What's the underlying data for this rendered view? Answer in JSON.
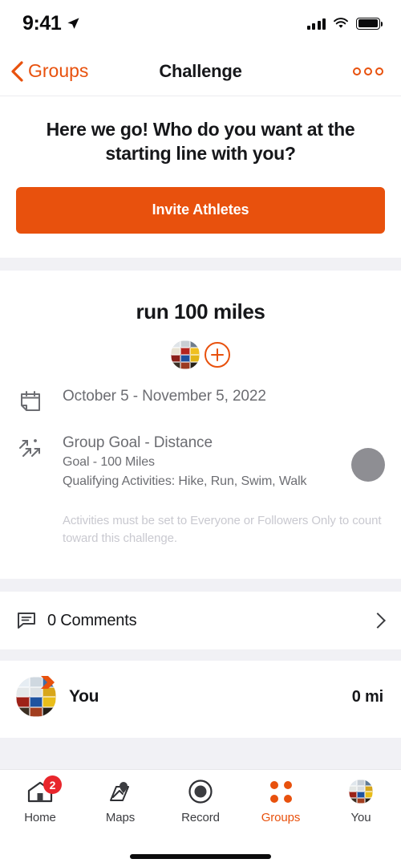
{
  "status_bar": {
    "time": "9:41",
    "location_icon": "location-arrow-icon",
    "signal_icon": "cellular-signal-icon",
    "wifi_icon": "wifi-icon",
    "battery_icon": "battery-full-icon"
  },
  "nav_bar": {
    "back_icon": "chevron-left-icon",
    "back_label": "Groups",
    "title": "Challenge",
    "more_icon": "more-options-icon"
  },
  "invite": {
    "headline": "Here we go! Who do you want at the starting line with you?",
    "button_label": "Invite Athletes"
  },
  "challenge": {
    "title": "run 100 miles",
    "avatar_name": "challenge-member-avatar",
    "add_button_icon": "plus-circle-icon",
    "rows": [
      {
        "icon": "calendar-icon",
        "main": "October 5 - November 5, 2022",
        "sub_lines": []
      },
      {
        "icon": "goal-arrows-icon",
        "main": "Group Goal - Distance",
        "sub_lines": [
          "Goal - 100 Miles",
          "Qualifying Activities: Hike, Run, Swim, Walk"
        ]
      }
    ],
    "progress_circle_name": "group-progress-circle",
    "disclaimer": "Activities must be set to Everyone or Followers Only to count toward this challenge."
  },
  "comments": {
    "icon": "comment-bubble-icon",
    "label": "0 Comments",
    "chevron_icon": "chevron-right-icon"
  },
  "leaderboard": {
    "rows": [
      {
        "name": "You",
        "value": "0 mi",
        "avatar_name": "user-avatar",
        "badge_icon": "chevron-badge-icon"
      }
    ]
  },
  "tab_bar": {
    "items": [
      {
        "label": "Home",
        "icon": "home-icon",
        "badge": "2",
        "active": false
      },
      {
        "label": "Maps",
        "icon": "map-pin-icon",
        "badge": "",
        "active": false
      },
      {
        "label": "Record",
        "icon": "record-icon",
        "badge": "",
        "active": false
      },
      {
        "label": "Groups",
        "icon": "groups-dots-icon",
        "badge": "",
        "active": true
      },
      {
        "label": "You",
        "icon": "profile-avatar-icon",
        "badge": "",
        "active": false
      }
    ]
  },
  "colors": {
    "accent_orange": "#e8510d",
    "badge_red": "#e8262c",
    "text_dark": "#16171a",
    "text_gray": "#6c6d72",
    "text_light": "#c9c9d0",
    "divider_gray": "#f1f1f5",
    "progress_gray": "#8e8e93"
  }
}
